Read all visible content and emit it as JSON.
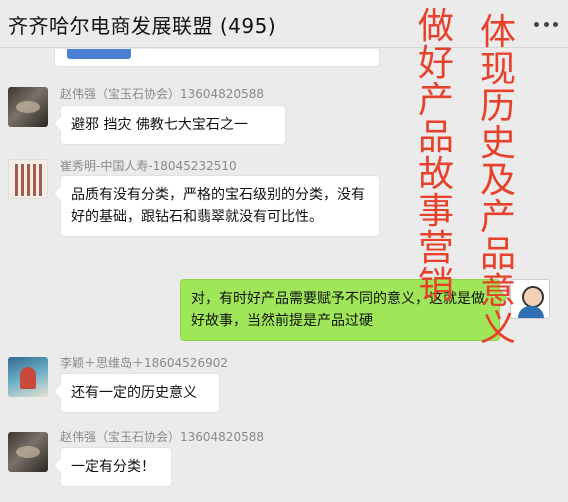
{
  "header": {
    "title": "齐齐哈尔电商发展联盟 (495)",
    "menu_icon": "more-dots-icon"
  },
  "messages": [
    {
      "sender": "赵伟强（宝玉石协会）13604820588",
      "text": "避邪  挡灾  佛教七大宝石之一"
    },
    {
      "sender": "崔秀明-中国人寿-18045232510",
      "text": "品质有没有分类，严格的宝石级别的分类，没有好的基础，跟钻石和翡翠就没有可比性。"
    },
    {
      "sender": "",
      "text": "对，有时好产品需要赋予不同的意义，这就是做好故事，当然前提是产品过硬",
      "from_me": true
    },
    {
      "sender": "李颖＋思维岛＋18604526902",
      "text": "还有一定的历史意义"
    },
    {
      "sender": "赵伟强（宝玉石协会）13604820588",
      "text": "一定有分类！"
    }
  ],
  "overlay": {
    "caption_left": "做好产品故事营销",
    "caption_right": "体现历史及产品意义",
    "color": "#e8412b"
  },
  "colors": {
    "background": "#ebebeb",
    "own_bubble": "#9fe658",
    "other_bubble": "#ffffff"
  }
}
